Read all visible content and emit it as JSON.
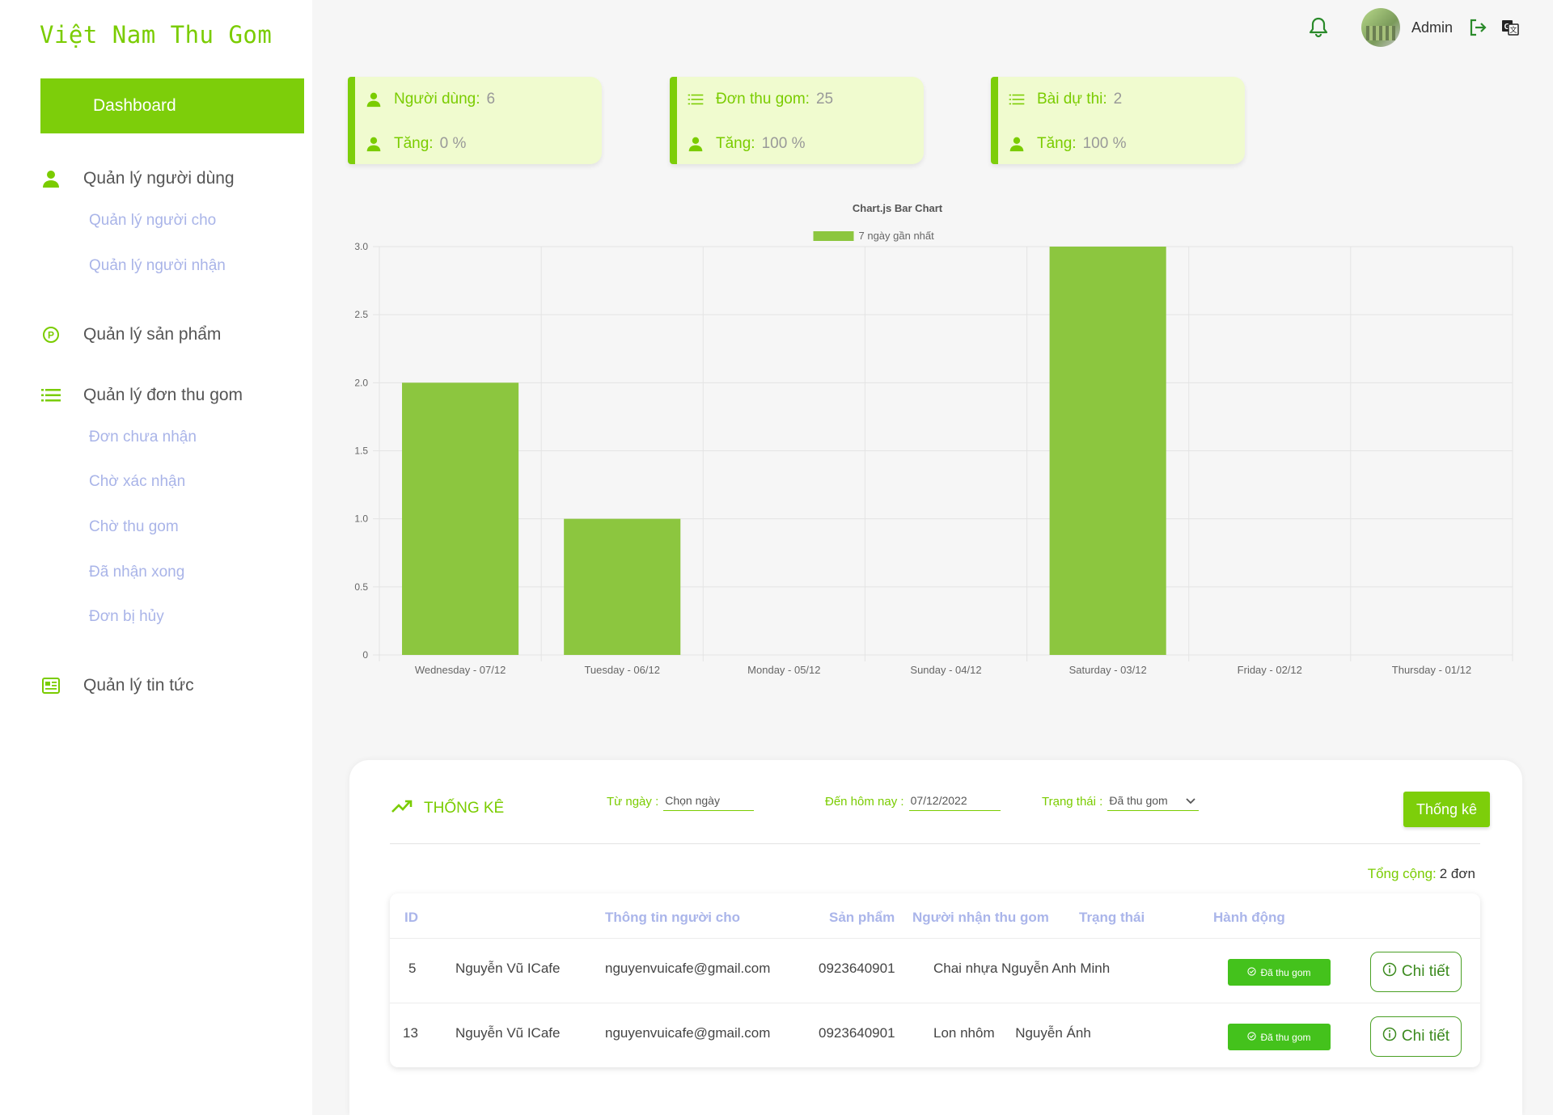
{
  "brand": "Việt Nam Thu Gom",
  "sidebar": {
    "dashboard": "Dashboard",
    "users": {
      "label": "Quản lý người dùng",
      "sub": [
        "Quản lý người cho",
        "Quản lý người nhận"
      ]
    },
    "products": {
      "label": "Quản lý sản phẩm"
    },
    "orders": {
      "label": "Quản lý đơn thu gom",
      "sub": [
        "Đơn chưa nhận",
        "Chờ xác nhận",
        "Chờ thu gom",
        "Đã nhận xong",
        "Đơn bị hủy"
      ]
    },
    "news": {
      "label": "Quản lý tin tức"
    }
  },
  "topbar": {
    "admin": "Admin"
  },
  "cards": [
    {
      "label": "Người dùng:",
      "value": "6",
      "inc_label": "Tăng:",
      "inc_value": "0 %"
    },
    {
      "label": "Đơn thu gom:",
      "value": "25",
      "inc_label": "Tăng:",
      "inc_value": "100 %"
    },
    {
      "label": "Bài dự thi:",
      "value": "2",
      "inc_label": "Tăng:",
      "inc_value": "100 %"
    }
  ],
  "chart_data": {
    "type": "bar",
    "title": "Chart.js Bar Chart",
    "categories": [
      "Wednesday - 07/12",
      "Tuesday - 06/12",
      "Monday - 05/12",
      "Sunday - 04/12",
      "Saturday - 03/12",
      "Friday - 02/12",
      "Thursday - 01/12"
    ],
    "series": [
      {
        "name": "7 ngày gần nhất",
        "values": [
          2,
          1,
          0,
          0,
          3,
          0,
          0
        ]
      }
    ],
    "ylim": [
      0,
      3
    ],
    "yticks": [
      "0",
      "0.5",
      "1.0",
      "1.5",
      "2.0",
      "2.5",
      "3.0"
    ],
    "grid": true,
    "legend": "top",
    "color": "#8cc63f"
  },
  "stats": {
    "title": "THỐNG KÊ",
    "from_label": "Từ ngày :",
    "from_value": "Chọn ngày",
    "to_label": "Đến hôm nay :",
    "to_value": "07/12/2022",
    "status_label": "Trạng thái :",
    "status_value": "Đã thu gom",
    "button": "Thống kê",
    "total_label": "Tổng cộng:",
    "total_value": "2 đơn"
  },
  "table": {
    "headers": [
      "ID",
      "Thông tin người cho",
      "Sản phẩm",
      "Người nhận thu gom",
      "Trạng thái",
      "Hành động"
    ],
    "rows": [
      {
        "id": "5",
        "name": "Nguyễn Vũ ICafe",
        "email": "nguyenvuicafe@gmail.com",
        "phone": "0923640901",
        "product": "Chai nhựa",
        "receiver": "Nguyễn Anh Minh",
        "status": "Đã thu gom",
        "action": "Chi tiết"
      },
      {
        "id": "13",
        "name": "Nguyễn Vũ ICafe",
        "email": "nguyenvuicafe@gmail.com",
        "phone": "0923640901",
        "product": "Lon nhôm",
        "receiver": "Nguyễn Ánh",
        "status": "Đã thu gom",
        "action": "Chi tiết"
      }
    ]
  }
}
